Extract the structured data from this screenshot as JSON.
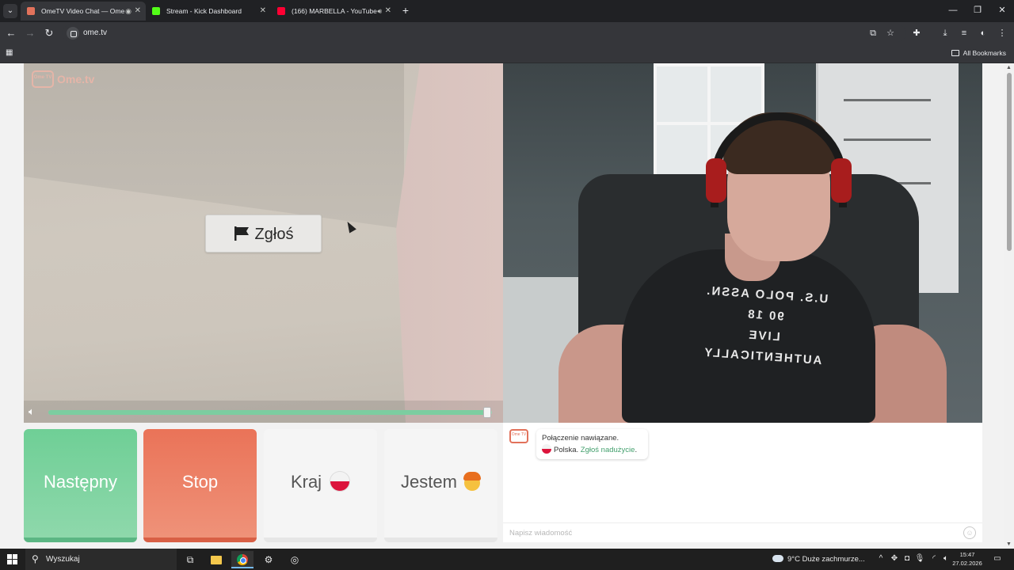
{
  "browser": {
    "tabs": [
      {
        "title": "OmeTV Video Chat — Ome",
        "active": true,
        "favicon_color": "#e2725b"
      },
      {
        "title": "Stream - Kick Dashboard",
        "active": false,
        "favicon_color": "#53fc18"
      },
      {
        "title": "(166) MARBELLA - YouTube",
        "active": false,
        "favicon_color": "#ff0033"
      }
    ],
    "url": "ome.tv",
    "all_bookmarks_label": "All Bookmarks"
  },
  "page": {
    "logo_text": "Ome.tv",
    "logo_badge": "Ome TV",
    "report_button": "Zgłoś",
    "volume_level": 0.99,
    "overlay_print": "U.S. POLO ASSN.\n90 18\nLIVE AUTHENTICALLY",
    "controls": {
      "next": "Następny",
      "stop": "Stop",
      "country": "Kraj",
      "gender": "Jestem"
    },
    "chat": {
      "badge": "Ome TV",
      "status_line": "Połączenie nawiązane.",
      "country": "Polska.",
      "report_link": "Zgłoś nadużycie",
      "report_link_suffix": ".",
      "input_placeholder": "Napisz wiadomość"
    }
  },
  "taskbar": {
    "search_label": "Wyszukaj",
    "weather": "9°C  Duże zachmurze...",
    "time": "15:47",
    "date": "27.02.2026"
  },
  "colors": {
    "next_green": "#6fcf96",
    "stop_red": "#ea7358",
    "link_green": "#44a06e",
    "volume_green": "#7ccda0"
  }
}
